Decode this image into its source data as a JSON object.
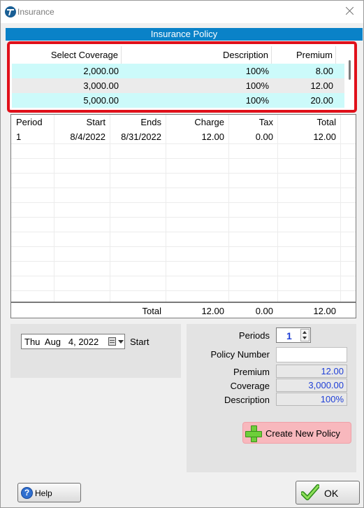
{
  "window": {
    "title": "Insurance"
  },
  "policy_header": "Insurance Policy",
  "coverage_table": {
    "columns": [
      "Select Coverage",
      "Description",
      "Premium"
    ],
    "rows": [
      [
        "2,000.00",
        "100%",
        "8.00"
      ],
      [
        "3,000.00",
        "100%",
        "12.00"
      ],
      [
        "5,000.00",
        "100%",
        "20.00"
      ]
    ]
  },
  "period_grid": {
    "columns": [
      "Period",
      "Start",
      "Ends",
      "Charge",
      "Tax",
      "Total"
    ],
    "rows": [
      [
        "1",
        "8/4/2022",
        "8/31/2022",
        "12.00",
        "0.00",
        "12.00"
      ]
    ],
    "total_row": {
      "label": "Total",
      "charge": "12.00",
      "tax": "0.00",
      "total": "12.00"
    }
  },
  "start_date": {
    "value": "Thu  Aug   4, 2022",
    "label": "Start"
  },
  "policy_form": {
    "periods_label": "Periods",
    "periods_value": "1",
    "policy_number_label": "Policy Number",
    "policy_number_value": "",
    "premium_label": "Premium",
    "premium_value": "12.00",
    "coverage_label": "Coverage",
    "coverage_value": "3,000.00",
    "description_label": "Description",
    "description_value": "100%",
    "create_button": "Create New Policy"
  },
  "footer": {
    "help_label": "Help",
    "ok_label": "OK"
  },
  "colors": {
    "header_blue": "#0a82c8",
    "highlight_red": "#e0101a",
    "row_cyan": "#ccfafa",
    "value_blue": "#1f3fd6",
    "create_button_pink": "#f8b8bd"
  },
  "icons": {
    "app": "insurance-logo-icon",
    "close": "close-icon",
    "calendar": "calendar-icon",
    "plus": "plus-icon",
    "help": "help-icon",
    "ok": "checkmark-icon"
  }
}
